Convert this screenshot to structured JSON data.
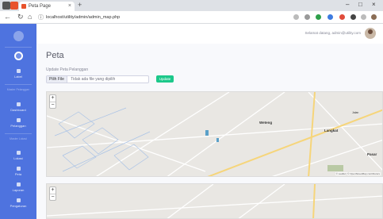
{
  "browser": {
    "tab_title": "Peta Page",
    "new_tab": "+",
    "url": "localhost/utility/admin/admin_map.php",
    "window_controls": [
      "–",
      "□",
      "×"
    ]
  },
  "sidebar": {
    "items": [
      {
        "label": "Label",
        "icon": "dashboard-icon"
      },
      {
        "label": "Master Pelanggan",
        "icon": "users-icon"
      },
      {
        "label": "Dashboard",
        "icon": "chart-icon"
      },
      {
        "label": "Pelanggan",
        "icon": "table-icon"
      },
      {
        "label": "Master Lokasi",
        "icon": "map-icon"
      },
      {
        "label": "Lokasi",
        "icon": "pin-icon"
      },
      {
        "label": "Peta",
        "icon": "globe-icon"
      },
      {
        "label": "Laporan",
        "icon": "file-icon"
      },
      {
        "label": "Pengaturan",
        "icon": "gear-icon"
      }
    ]
  },
  "topbar": {
    "username": "Selamat datang, admin@utility.com"
  },
  "main": {
    "page_title": "Peta",
    "upload_label": "Update Peta Pelanggan",
    "file_button": "Pilih File",
    "file_placeholder": "Tidak ada file yang dipilih",
    "upload_button": "Update"
  },
  "maps": [
    {
      "labels": {
        "a": "Weteng",
        "b": "Langkat",
        "c": "Pasar",
        "d": "Jalan"
      },
      "attribution": "© Leaflet | © OpenStreetMap contributors"
    },
    {
      "labels": {
        "a": "",
        "b": "",
        "c": "",
        "d": ""
      },
      "attribution": ""
    }
  ],
  "colors": {
    "sidebar": "#4e73df",
    "upload": "#1cc88a",
    "map_bg": "#e9e7e3",
    "road_major": "#f6d57a"
  }
}
